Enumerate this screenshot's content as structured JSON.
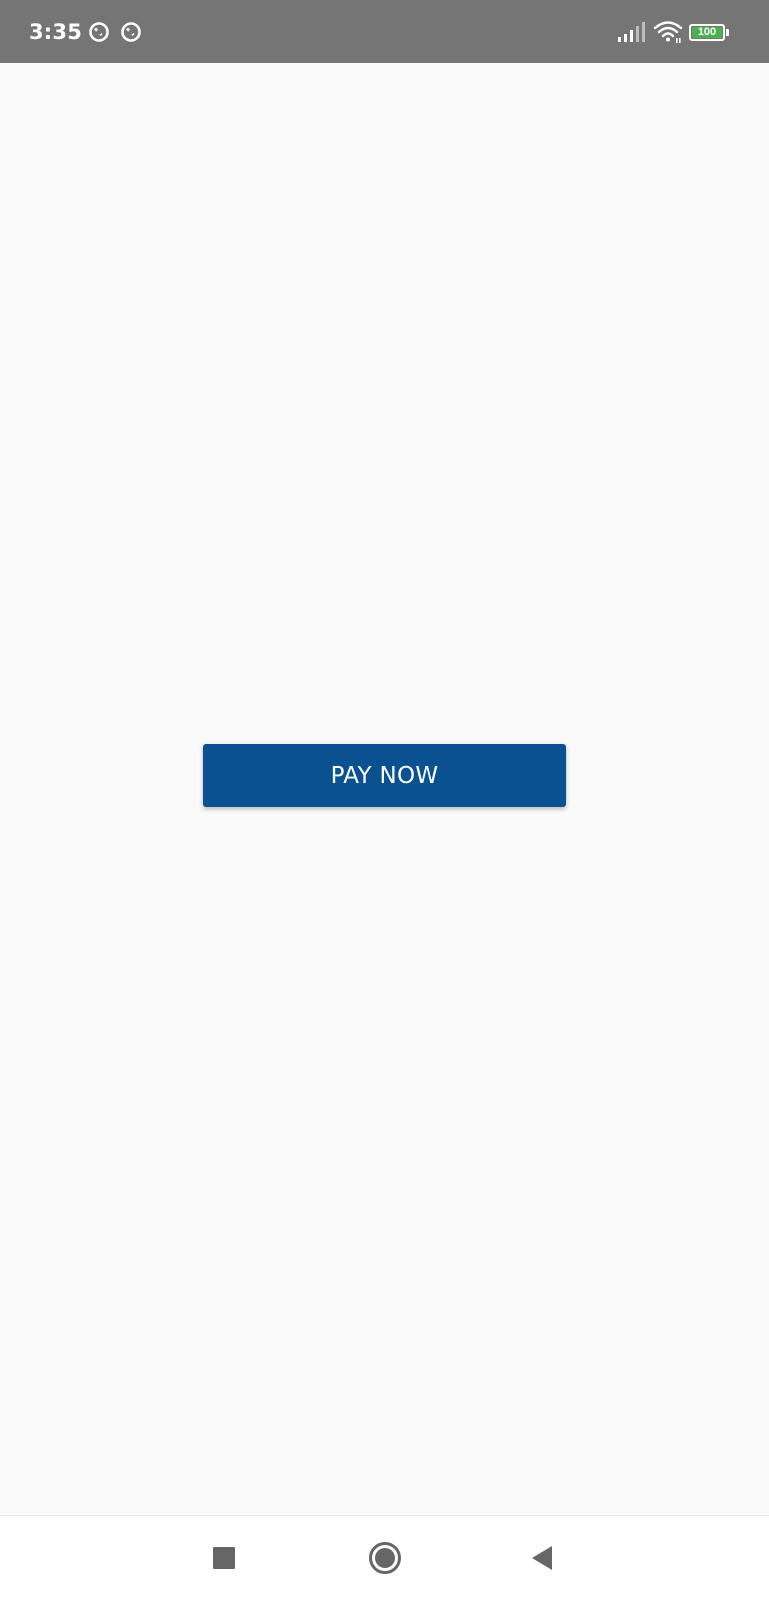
{
  "status_bar": {
    "time": "3:35",
    "notification_icons": [
      "notification-app-icon",
      "notification-app-icon"
    ],
    "signal_icon": "cellular-signal-icon",
    "wifi_icon": "wifi-icon",
    "battery_level": "100",
    "battery_color": "#4caf50"
  },
  "main": {
    "pay_button_label": "PAY NOW",
    "accent_color": "#0a5191"
  },
  "nav_bar": {
    "recents_icon": "square-recents-icon",
    "home_icon": "circle-home-icon",
    "back_icon": "triangle-back-icon"
  }
}
